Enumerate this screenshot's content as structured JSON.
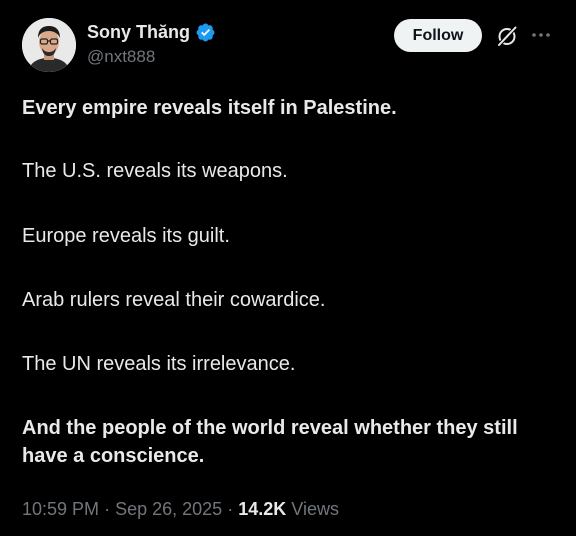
{
  "user": {
    "display_name": "Sony Thăng",
    "handle": "@nxt888",
    "verified": true,
    "avatar_icon": "profile-photo"
  },
  "actions": {
    "follow_label": "Follow",
    "grok_icon": "grok-icon",
    "more_icon": "more-dots-icon"
  },
  "tweet": {
    "paragraphs": [
      "Every empire reveals itself in Palestine.",
      "The U.S. reveals its weapons.",
      "Europe reveals its guilt.",
      "Arab rulers reveal their cowardice.",
      "The UN reveals its irrelevance.",
      "And the people of the world reveal whether they still have a conscience."
    ]
  },
  "meta": {
    "time": "10:59 PM",
    "separator": "·",
    "date": "Sep 26, 2025",
    "views_count": "14.2K",
    "views_label": "Views"
  },
  "colors": {
    "background": "#000000",
    "text": "#e7e9ea",
    "secondary_text": "#71767b",
    "verified_badge": "#1d9bf0",
    "follow_bg": "#eff3f4"
  }
}
